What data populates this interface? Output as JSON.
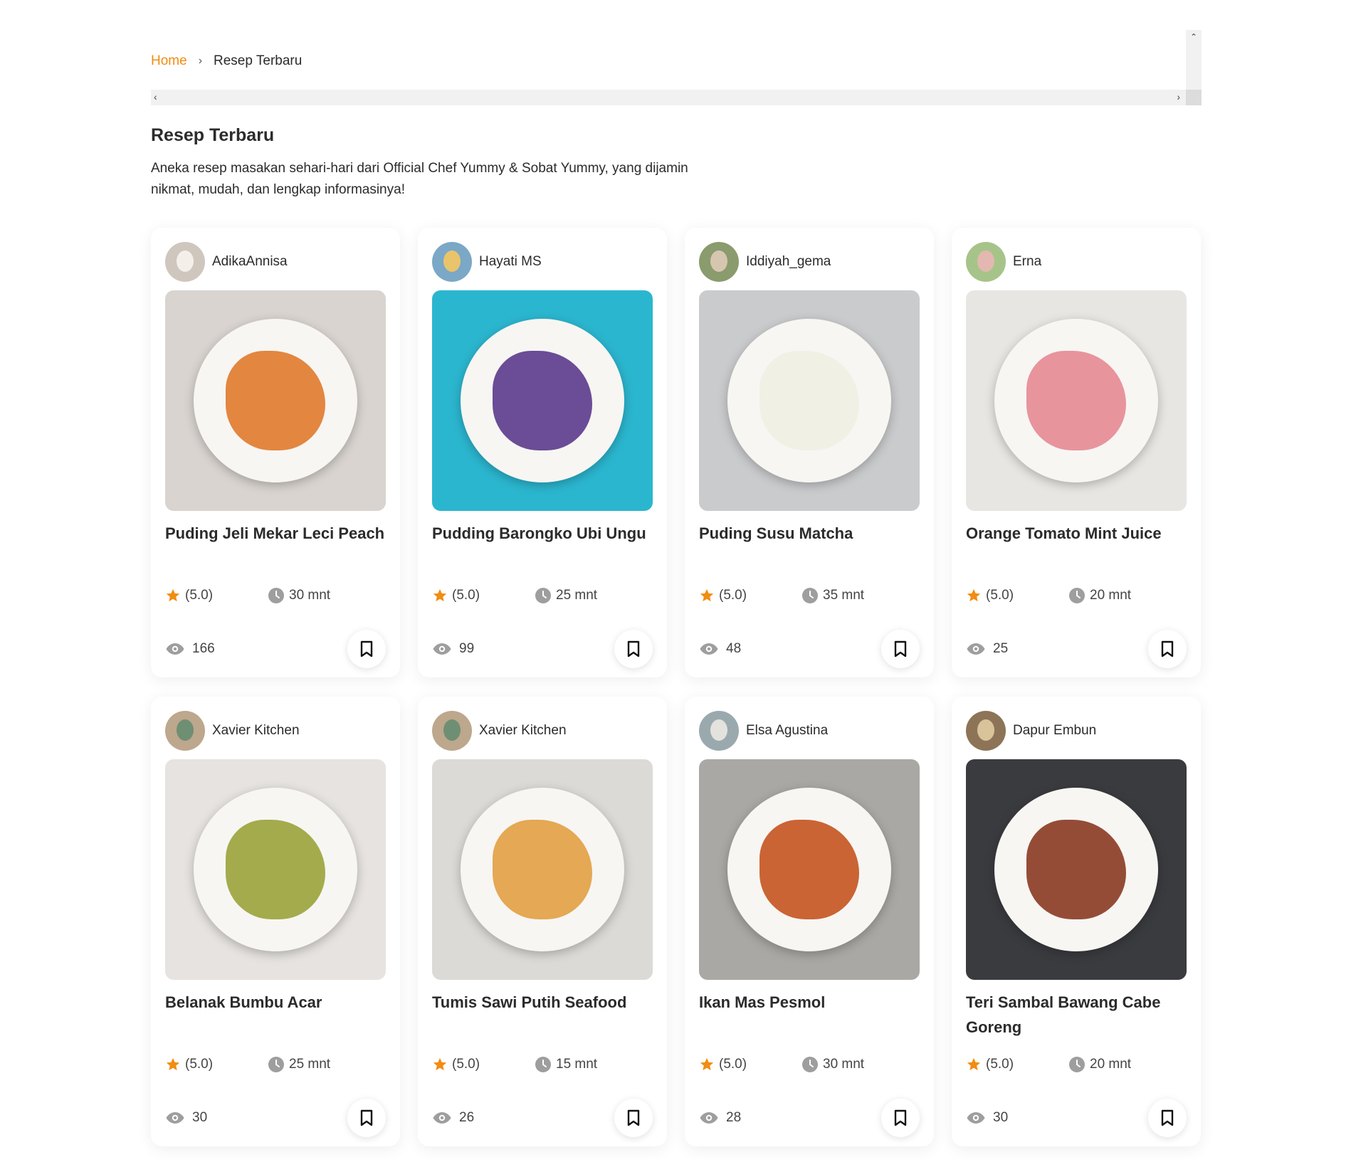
{
  "breadcrumb": {
    "home": "Home",
    "separator": "›",
    "current": "Resep Terbaru"
  },
  "page": {
    "title": "Resep Terbaru",
    "description": "Aneka resep masakan sehari-hari dari Official Chef Yummy & Sobat Yummy, yang dijamin nikmat, mudah, dan lengkap informasinya!"
  },
  "colors": {
    "accent": "#f28c12",
    "star": "#f28c12",
    "icon_gray": "#9e9e9e"
  },
  "recipes": [
    {
      "author": "AdikaAnnisa",
      "title": "Puding Jeli Mekar Leci Peach",
      "rating": "(5.0)",
      "time": "30 mnt",
      "views": "166",
      "photo": {
        "bg": "#d9d4cf",
        "accent": "#e07a2c"
      },
      "avatar": {
        "bg": "#cfc6bd",
        "accent": "#f4efe9"
      }
    },
    {
      "author": "Hayati MS",
      "title": "Pudding Barongko Ubi Ungu",
      "rating": "(5.0)",
      "time": "25 mnt",
      "views": "99",
      "photo": {
        "bg": "#2bb6cf",
        "accent": "#5b3a8c"
      },
      "avatar": {
        "bg": "#7aa8c6",
        "accent": "#e9c46a"
      }
    },
    {
      "author": "Iddiyah_gema",
      "title": "Puding Susu Matcha",
      "rating": "(5.0)",
      "time": "35 mnt",
      "views": "48",
      "photo": {
        "bg": "#c9cbcd",
        "accent": "#eef0e3"
      },
      "avatar": {
        "bg": "#8a9b6d",
        "accent": "#d6c6b0"
      }
    },
    {
      "author": "Erna",
      "title": "Orange Tomato Mint Juice",
      "rating": "(5.0)",
      "time": "20 mnt",
      "views": "25",
      "photo": {
        "bg": "#e8e6e3",
        "accent": "#e58a93"
      },
      "avatar": {
        "bg": "#a6c48a",
        "accent": "#e2b8b0"
      }
    },
    {
      "author": "Xavier Kitchen",
      "title": "Belanak Bumbu Acar",
      "rating": "(5.0)",
      "time": "25 mnt",
      "views": "30",
      "photo": {
        "bg": "#e6e3e0",
        "accent": "#9aa33a"
      },
      "avatar": {
        "bg": "#bda78d",
        "accent": "#6f8f74"
      }
    },
    {
      "author": "Xavier Kitchen",
      "title": "Tumis Sawi Putih Seafood",
      "rating": "(5.0)",
      "time": "15 mnt",
      "views": "26",
      "photo": {
        "bg": "#dcdad6",
        "accent": "#e2a042"
      },
      "avatar": {
        "bg": "#bda78d",
        "accent": "#6f8f74"
      }
    },
    {
      "author": "Elsa Agustina",
      "title": "Ikan Mas Pesmol",
      "rating": "(5.0)",
      "time": "30 mnt",
      "views": "28",
      "photo": {
        "bg": "#a9a8a4",
        "accent": "#c4541f"
      },
      "avatar": {
        "bg": "#9aa9ad",
        "accent": "#e4e2dd"
      }
    },
    {
      "author": "Dapur Embun",
      "title": "Teri Sambal Bawang Cabe Goreng",
      "rating": "(5.0)",
      "time": "20 mnt",
      "views": "30",
      "photo": {
        "bg": "#3a3b3f",
        "accent": "#8a3a22"
      },
      "avatar": {
        "bg": "#8d7457",
        "accent": "#d8c39a"
      }
    }
  ]
}
